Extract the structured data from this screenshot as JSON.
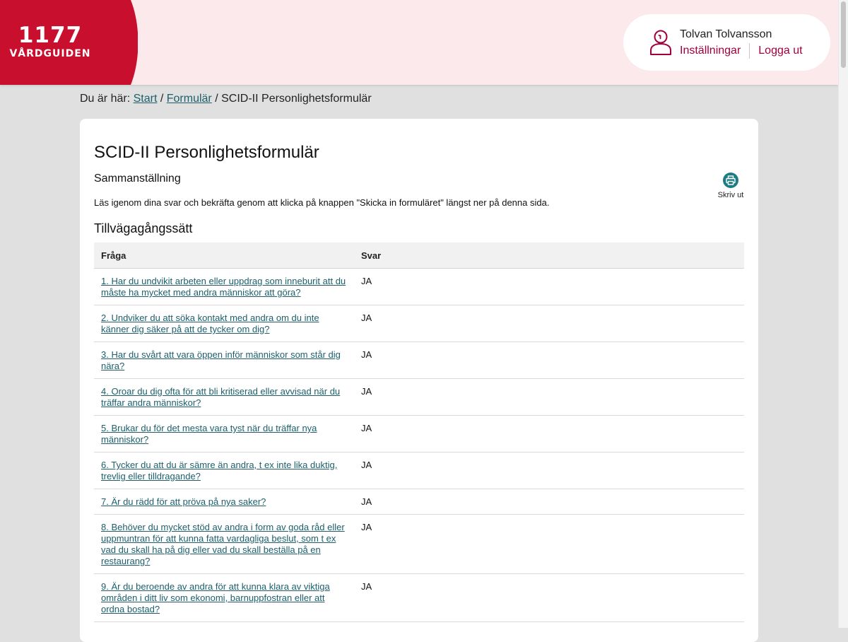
{
  "header": {
    "logo": {
      "number": "1177",
      "name": "VÅRDGUIDEN"
    },
    "user": {
      "name": "Tolvan Tolvansson",
      "settings_label": "Inställningar",
      "logout_label": "Logga ut"
    }
  },
  "breadcrumb": {
    "prefix": "Du är här:",
    "items": [
      {
        "label": "Start"
      },
      {
        "label": "Formulär"
      }
    ],
    "current": "SCID-II Personlighetsformulär",
    "separator": "/"
  },
  "main": {
    "title": "SCID-II Personlighetsformulär",
    "subtitle": "Sammanställning",
    "print_label": "Skriv ut",
    "intro": "Läs igenom dina svar och bekräfta genom att klicka på knappen \"Skicka in formuläret\" längst ner på denna sida.",
    "section_title": "Tillvägagångssätt",
    "table": {
      "headers": {
        "question": "Fråga",
        "answer": "Svar"
      },
      "rows": [
        {
          "question": "1. Har du undvikit arbeten eller uppdrag som inneburit att du måste ha mycket med andra människor att göra?",
          "answer": "JA"
        },
        {
          "question": "2. Undviker du att söka kontakt med andra om du inte känner dig säker på att de tycker om dig?",
          "answer": "JA"
        },
        {
          "question": "3. Har du svårt att vara öppen inför människor som står dig nära?",
          "answer": "JA"
        },
        {
          "question": "4. Oroar du dig ofta för att bli kritiserad eller avvisad när du träffar andra människor?",
          "answer": "JA"
        },
        {
          "question": "5. Brukar du för det mesta vara tyst när du träffar nya människor?",
          "answer": "JA"
        },
        {
          "question": "6. Tycker du att du är sämre än andra, t ex inte lika duktig, trevlig eller tilldragande?",
          "answer": "JA"
        },
        {
          "question": "7. Är du rädd för att pröva på nya saker?",
          "answer": "JA"
        },
        {
          "question": "8. Behöver du mycket stöd av andra i form av goda råd eller uppmuntran för att kunna fatta vardagliga beslut, som t ex vad du skall ha på dig eller vad du skall beställa på en restaurang?",
          "answer": "JA"
        },
        {
          "question": "9. Är du beroende av andra för att kunna klara av viktiga områden i ditt liv som ekonomi, barnuppfostran eller att ordna bostad?",
          "answer": "JA"
        }
      ]
    }
  },
  "colors": {
    "brand": "#c8102e",
    "header_bg": "#fbe9ec",
    "link": "#1c5f6b",
    "user_link": "#a1003d",
    "page_bg": "#e0e0e0",
    "print_icon_bg": "#1c7c82"
  },
  "icons": {
    "user": "user-icon",
    "print": "printer-icon"
  }
}
